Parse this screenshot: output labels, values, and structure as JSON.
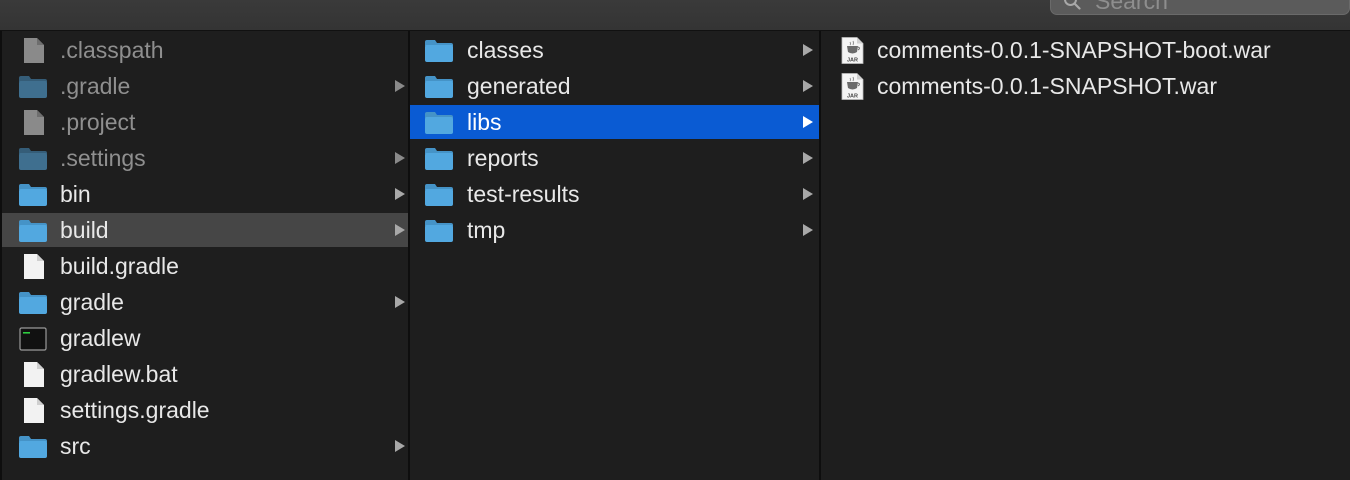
{
  "search": {
    "placeholder": "Search"
  },
  "colors": {
    "background": "#1e1e1e",
    "selected_active": "#0a5bd3",
    "selected_inactive": "#464646",
    "folder": "#52a8e0",
    "text": "#e8e8e8",
    "text_hidden": "#8f8f8f"
  },
  "columns": [
    {
      "items": [
        {
          "label": ".classpath",
          "icon": "document-icon",
          "hidden": true,
          "has_children": false
        },
        {
          "label": ".gradle",
          "icon": "folder-icon",
          "hidden": true,
          "has_children": true
        },
        {
          "label": ".project",
          "icon": "document-icon",
          "hidden": true,
          "has_children": false
        },
        {
          "label": ".settings",
          "icon": "folder-icon",
          "hidden": true,
          "has_children": true
        },
        {
          "label": "bin",
          "icon": "folder-icon",
          "hidden": false,
          "has_children": true
        },
        {
          "label": "build",
          "icon": "folder-icon",
          "hidden": false,
          "has_children": true,
          "selected": "inactive"
        },
        {
          "label": "build.gradle",
          "icon": "document-icon",
          "hidden": false,
          "has_children": false
        },
        {
          "label": "gradle",
          "icon": "folder-icon",
          "hidden": false,
          "has_children": true
        },
        {
          "label": "gradlew",
          "icon": "terminal-icon",
          "hidden": false,
          "has_children": false
        },
        {
          "label": "gradlew.bat",
          "icon": "document-icon",
          "hidden": false,
          "has_children": false
        },
        {
          "label": "settings.gradle",
          "icon": "document-icon",
          "hidden": false,
          "has_children": false
        },
        {
          "label": "src",
          "icon": "folder-icon",
          "hidden": false,
          "has_children": true
        }
      ]
    },
    {
      "items": [
        {
          "label": "classes",
          "icon": "folder-icon",
          "hidden": false,
          "has_children": true
        },
        {
          "label": "generated",
          "icon": "folder-icon",
          "hidden": false,
          "has_children": true
        },
        {
          "label": "libs",
          "icon": "folder-icon",
          "hidden": false,
          "has_children": true,
          "selected": "active"
        },
        {
          "label": "reports",
          "icon": "folder-icon",
          "hidden": false,
          "has_children": true
        },
        {
          "label": "test-results",
          "icon": "folder-icon",
          "hidden": false,
          "has_children": true
        },
        {
          "label": "tmp",
          "icon": "folder-icon",
          "hidden": false,
          "has_children": true
        }
      ]
    },
    {
      "items": [
        {
          "label": "comments-0.0.1-SNAPSHOT-boot.war",
          "icon": "jar-file-icon",
          "icon_text": "JAR",
          "hidden": false,
          "has_children": false
        },
        {
          "label": "comments-0.0.1-SNAPSHOT.war",
          "icon": "jar-file-icon",
          "icon_text": "JAR",
          "hidden": false,
          "has_children": false
        }
      ]
    }
  ]
}
